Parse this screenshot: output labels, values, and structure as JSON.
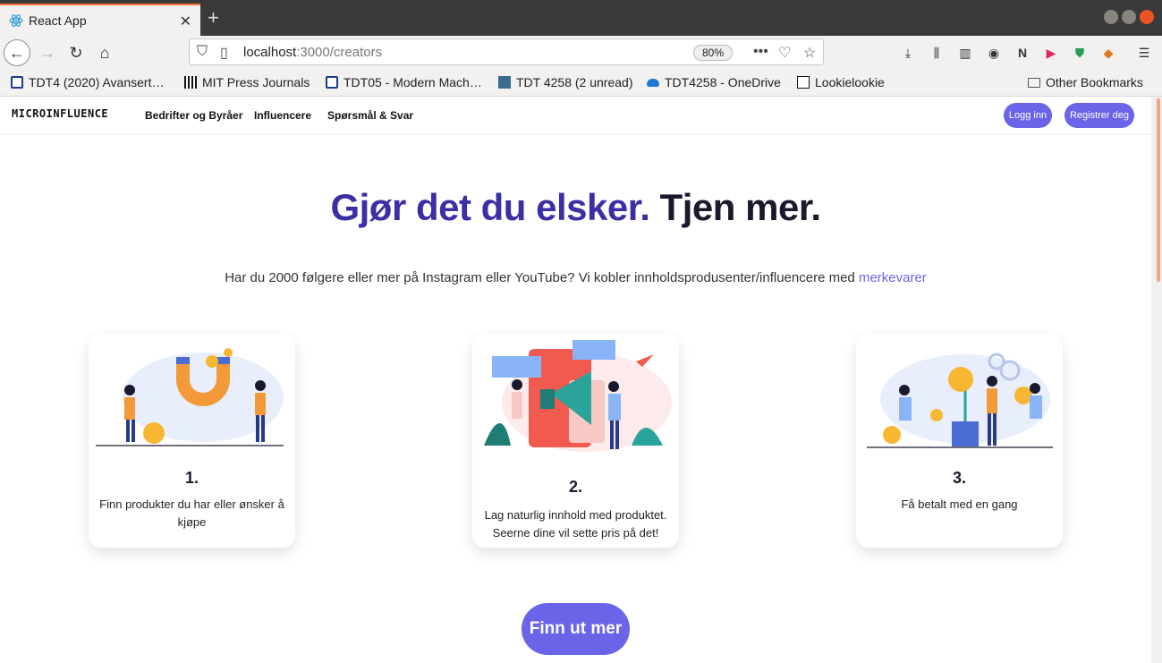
{
  "browser": {
    "tab_title": "React App",
    "url_host": "localhost",
    "url_path": ":3000/creators",
    "zoom": "80%"
  },
  "bookmarks": [
    {
      "label": "TDT4 (2020) Avansert…"
    },
    {
      "label": "MIT Press Journals"
    },
    {
      "label": "TDT05 - Modern Mach…"
    },
    {
      "label": "TDT 4258 (2 unread)"
    },
    {
      "label": "TDT4258 - OneDrive"
    },
    {
      "label": "Lookielookie"
    },
    {
      "label": "Other Bookmarks"
    }
  ],
  "site": {
    "brand": "MICROINFLUENCE",
    "nav": [
      "Bedrifter og Byråer",
      "Influencere",
      "Spørsmål & Svar"
    ],
    "login": "Logg inn",
    "register": "Registrer deg"
  },
  "hero": {
    "part1": "Gjør det du elsker.",
    "part2": "Tjen mer.",
    "subtitle": "Har du 2000 følgere eller mer på Instagram eller YouTube? Vi kobler innholdsprodusenter/influencere med",
    "subtitle_link": "merkevarer"
  },
  "steps": [
    {
      "num": "1.",
      "text": "Finn produkter du har eller ønsker å kjøpe"
    },
    {
      "num": "2.",
      "text": "Lag naturlig innhold med produktet. Seerne dine vil sette pris på det!"
    },
    {
      "num": "3.",
      "text": "Få betalt med en gang"
    }
  ],
  "cta": "Finn ut mer",
  "colors": {
    "accent": "#6b64e8",
    "hero_blue": "#3b2fa5"
  }
}
